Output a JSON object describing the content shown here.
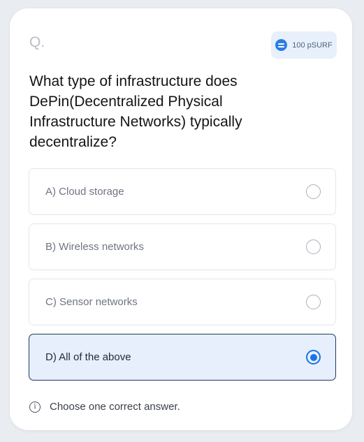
{
  "header": {
    "question_marker": "Q.",
    "reward": {
      "label": "100 pSURF",
      "icon": "coin-icon"
    }
  },
  "question": {
    "text": "What type of infrastructure does DePin(Decentralized Physical Infrastructure Networks) typically decentralize?"
  },
  "options": [
    {
      "label": "A) Cloud storage",
      "selected": false
    },
    {
      "label": "B) Wireless networks",
      "selected": false
    },
    {
      "label": "C) Sensor networks",
      "selected": false
    },
    {
      "label": "D) All of the above",
      "selected": true
    }
  ],
  "footer": {
    "hint": "Choose one correct answer.",
    "icon": "info-icon"
  },
  "colors": {
    "accent": "#1a73e8",
    "selected_bg": "#e6effb",
    "selected_border": "#1e3a66"
  }
}
